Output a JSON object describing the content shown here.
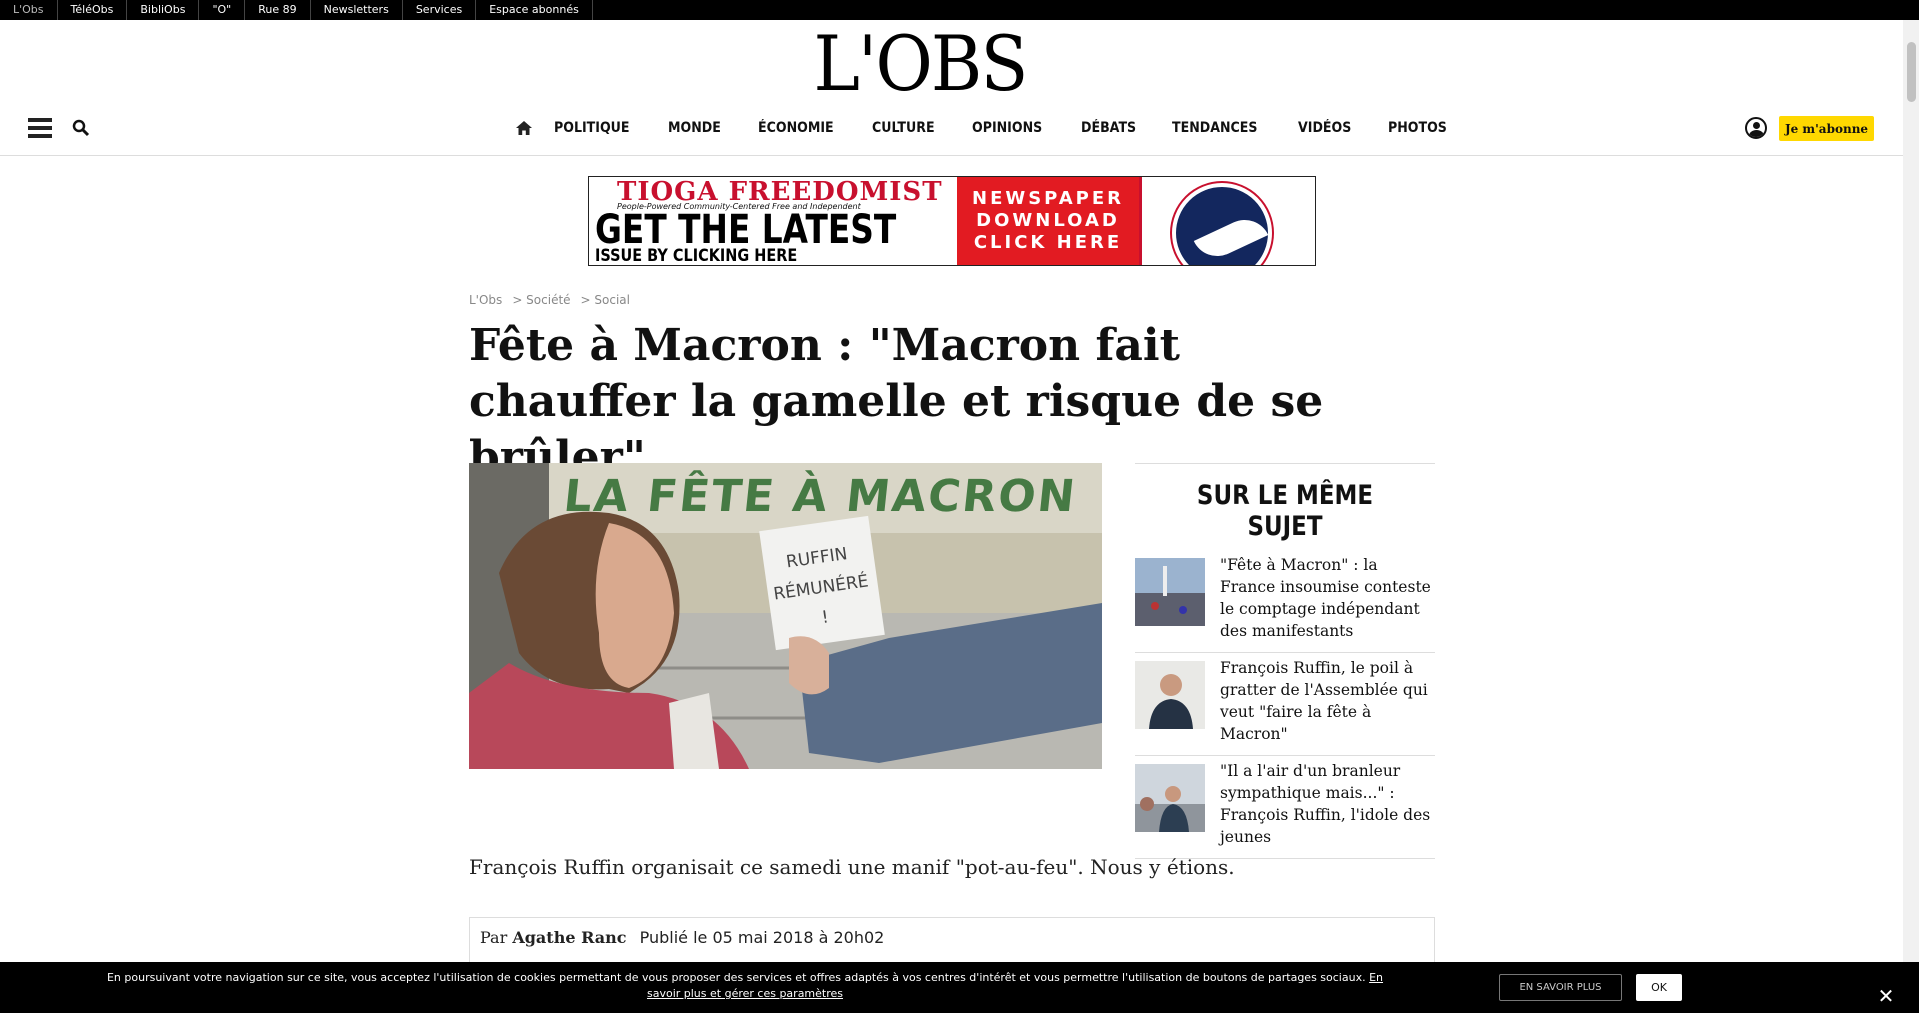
{
  "topbar": {
    "links": [
      "L'Obs",
      "TéléObs",
      "BibliObs",
      "\"O\"",
      "Rue 89",
      "Newsletters",
      "Services",
      "Espace abonnés"
    ]
  },
  "header": {
    "logo_text": "L'OBS",
    "nav": [
      "POLITIQUE",
      "MONDE",
      "ÉCONOMIE",
      "CULTURE",
      "OPINIONS",
      "DÉBATS",
      "TENDANCES",
      "VIDÉOS",
      "PHOTOS"
    ],
    "subscribe_label": "Je m'abonne"
  },
  "ad": {
    "brand": "TIOGA FREEDOMIST",
    "tagline": "People-Powered   Community-Centered   Free and Independent",
    "headline": "GET THE LATEST",
    "subline": "ISSUE BY CLICKING HERE",
    "cta_lines": [
      "NEWSPAPER",
      "DOWNLOAD",
      "CLICK HERE"
    ]
  },
  "breadcrumb": [
    "L'Obs",
    "> Société",
    "> Social"
  ],
  "article": {
    "title": "Fête à Macron : \"Macron fait chauffer la gamelle et risque de se brûler\"",
    "lead": "François Ruffin organisait ce samedi une manif \"pot-au-feu\". Nous y étions.",
    "byline_prefix": "Par",
    "author": "Agathe Ranc",
    "published": "Publié le 05 mai 2018 à 20h02",
    "image_banner_text": "LA FÊTE À MACRON",
    "image_sign_text": "RUFFIN RÉMUNÉRÉ !"
  },
  "sidebar": {
    "heading": "SUR LE MÊME SUJET",
    "items": [
      {
        "text": "\"Fête à Macron\" : la France insoumise conteste le comptage indépendant des manifestants"
      },
      {
        "text": "François Ruffin, le poil à gratter de l'Assemblée qui veut \"faire la fête à Macron\""
      },
      {
        "text": "\"Il a l'air d'un branleur sympathique mais...\" : François Ruffin, l'idole des jeunes"
      }
    ]
  },
  "cookie": {
    "message": "En poursuivant votre navigation sur ce site, vous acceptez l'utilisation de cookies permettant de vous proposer des services et offres adaptés à vos centres d'intérêt et vous permettre l'utilisation de boutons de partages sociaux.",
    "link": "En savoir plus et gérer ces paramètres",
    "more_label": "EN SAVOIR PLUS",
    "ok_label": "OK",
    "close_glyph": "✕"
  },
  "colors": {
    "accent_yellow": "#ffd800",
    "topbar": "#000000",
    "ad_red": "#e21b22"
  }
}
